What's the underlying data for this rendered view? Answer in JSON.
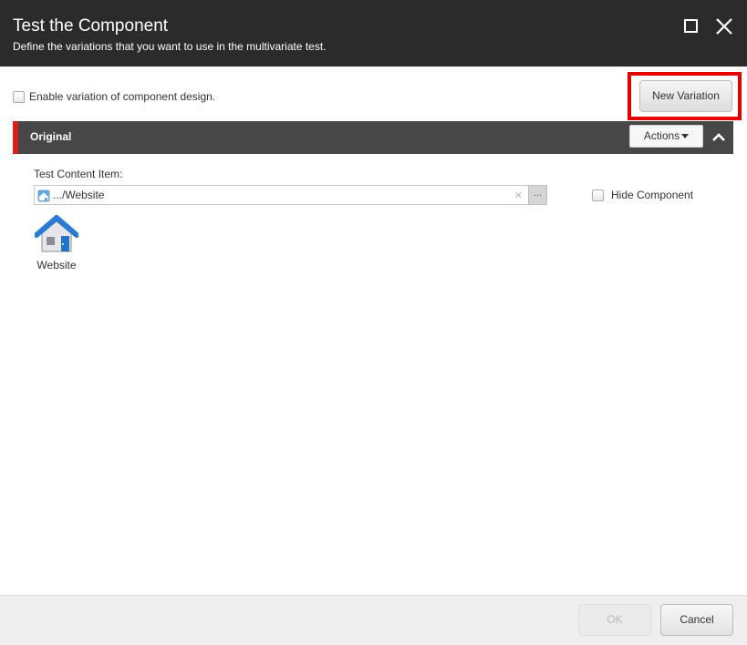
{
  "dialog": {
    "title": "Test the Component",
    "subtitle": "Define the variations that you want to use in the multivariate test."
  },
  "window_controls": {
    "maximize_icon": "maximize-icon",
    "close_icon": "close-icon"
  },
  "options": {
    "enable_variation_label": "Enable variation of component design.",
    "enable_variation_checked": false,
    "new_variation_label": "New Variation"
  },
  "variation": {
    "name": "Original",
    "actions_label": "Actions",
    "collapse_icon": "chevron-up-icon",
    "content_item_label": "Test Content Item:",
    "content_item_path": ".../Website",
    "clear_icon": "clear-icon",
    "clear_symbol": "×",
    "browse_label": "...",
    "hide_component_label": "Hide Component",
    "hide_component_checked": false,
    "item_name": "Website",
    "item_icon": "house-icon"
  },
  "footer": {
    "ok_label": "OK",
    "ok_disabled": true,
    "cancel_label": "Cancel"
  },
  "colors": {
    "header_bg": "#2b2b2b",
    "section_bar_bg": "#474747",
    "section_accent": "#d9201a",
    "highlight_border": "#e60000"
  }
}
